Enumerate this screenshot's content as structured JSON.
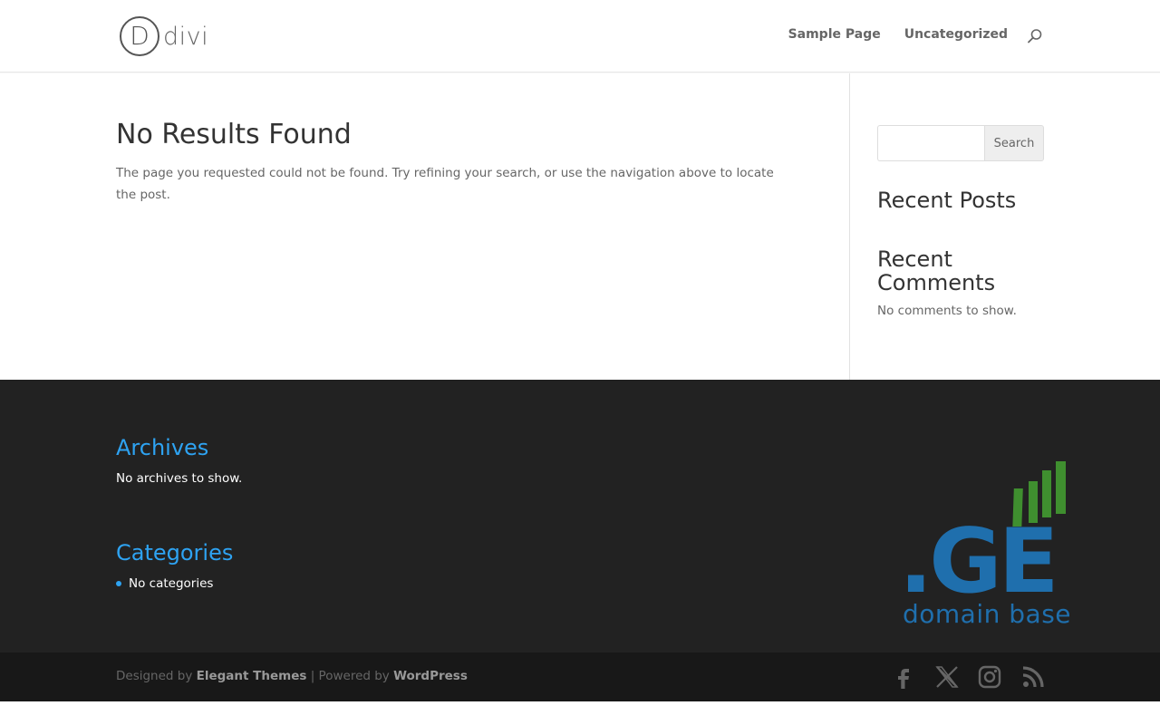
{
  "header": {
    "logo_letter": "D",
    "logo_text": "divi",
    "nav": [
      {
        "label": "Sample Page"
      },
      {
        "label": "Uncategorized"
      }
    ]
  },
  "content": {
    "title": "No Results Found",
    "message": "The page you requested could not be found. Try refining your search, or use the navigation above to locate the post."
  },
  "sidebar": {
    "search": {
      "value": "",
      "button_label": "Search"
    },
    "recent_posts_title": "Recent Posts",
    "recent_comments_title": "Recent Comments",
    "recent_comments_text": "No comments to show."
  },
  "footer": {
    "archives_title": "Archives",
    "archives_text": "No archives to show.",
    "categories_title": "Categories",
    "categories_item": "No categories",
    "brand_logo_text": ".GE",
    "brand_text": "domain base"
  },
  "bottom": {
    "designed_by": "Designed by ",
    "elegant_themes": "Elegant Themes",
    "powered_by": " | Powered by ",
    "wordpress": "WordPress",
    "social_icons": [
      "facebook-icon",
      "x-icon",
      "instagram-icon",
      "rss-icon"
    ]
  },
  "colors": {
    "accent": "#2ea3f2",
    "footer_bg": "#222222",
    "bottom_bg": "#181818",
    "brand_blue": "#1f6fad",
    "brand_green": "#3f8f2f"
  }
}
